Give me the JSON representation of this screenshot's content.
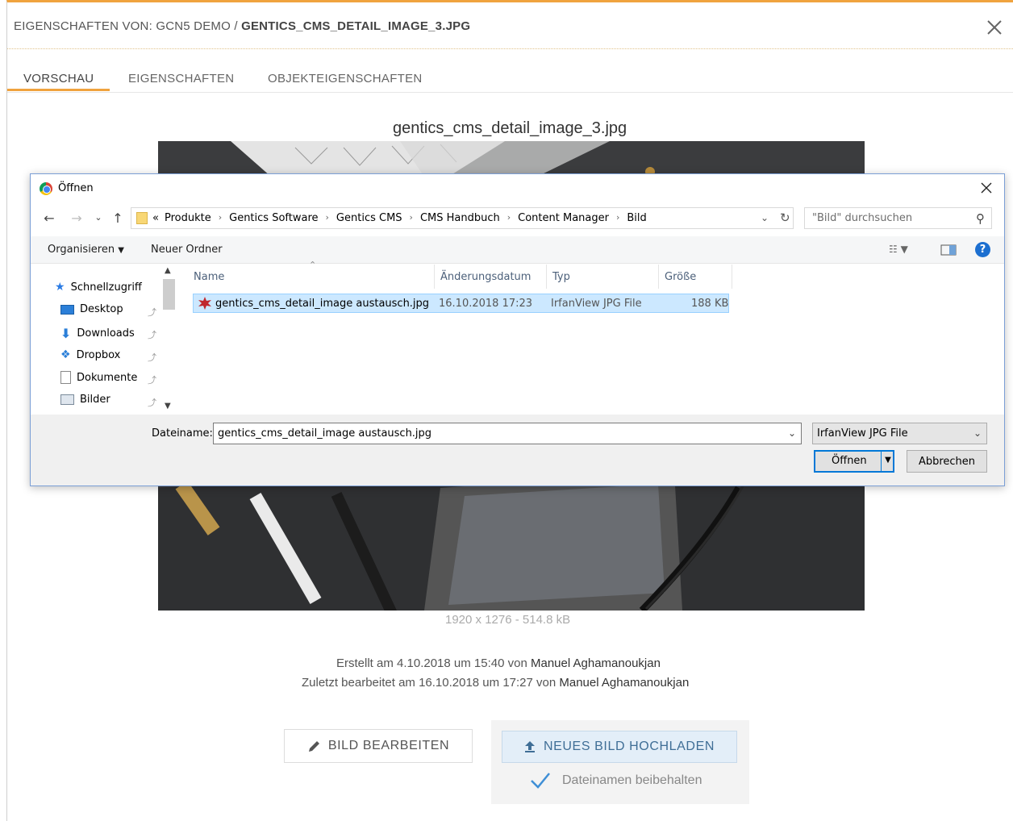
{
  "modal": {
    "title_prefix": "EIGENSCHAFTEN VON: GCN5 DEMO / ",
    "title_file": "GENTICS_CMS_DETAIL_IMAGE_3.JPG",
    "tabs": [
      {
        "label": "VORSCHAU",
        "active": true
      },
      {
        "label": "EIGENSCHAFTEN",
        "active": false
      },
      {
        "label": "OBJEKTEIGENSCHAFTEN",
        "active": false
      }
    ],
    "image_title": "gentics_cms_detail_image_3.jpg",
    "image_dims": "1920 x 1276 - 514.8 kB",
    "created_text": "Erstellt am 4.10.2018 um 15:40 von ",
    "created_by": "Manuel Aghamanoukjan",
    "edited_text": "Zuletzt bearbeitet am 16.10.2018 um 17:27 von ",
    "edited_by": "Manuel Aghamanoukjan",
    "edit_button": "BILD BEARBEITEN",
    "upload_button": "NEUES BILD HOCHLADEN",
    "keep_name": "Dateinamen beibehalten",
    "accent_color": "#f0a33e"
  },
  "dialog": {
    "title": "Öffnen",
    "address_prefix": "«",
    "breadcrumbs": [
      "Produkte",
      "Gentics Software",
      "Gentics CMS",
      "CMS Handbuch",
      "Content Manager",
      "Bild"
    ],
    "search_placeholder": "\"Bild\" durchsuchen",
    "organize": "Organisieren",
    "new_folder": "Neuer Ordner",
    "sidebar": [
      {
        "label": "Schnellzugriff",
        "icon": "star-icon"
      },
      {
        "label": "Desktop",
        "icon": "desktop-icon"
      },
      {
        "label": "Downloads",
        "icon": "download-icon"
      },
      {
        "label": "Dropbox",
        "icon": "dropbox-icon"
      },
      {
        "label": "Dokumente",
        "icon": "document-icon"
      },
      {
        "label": "Bilder",
        "icon": "pictures-icon"
      }
    ],
    "columns": [
      "Name",
      "Änderungsdatum",
      "Typ",
      "Größe"
    ],
    "files": [
      {
        "name": "gentics_cms_detail_image austausch.jpg",
        "date": "16.10.2018 17:23",
        "type": "IrfanView JPG File",
        "size": "188 KB"
      }
    ],
    "filename_label": "Dateiname:",
    "filename_value": "gentics_cms_detail_image austausch.jpg",
    "filter": "IrfanView JPG File",
    "open_button": "Öffnen",
    "cancel_button": "Abbrechen"
  }
}
